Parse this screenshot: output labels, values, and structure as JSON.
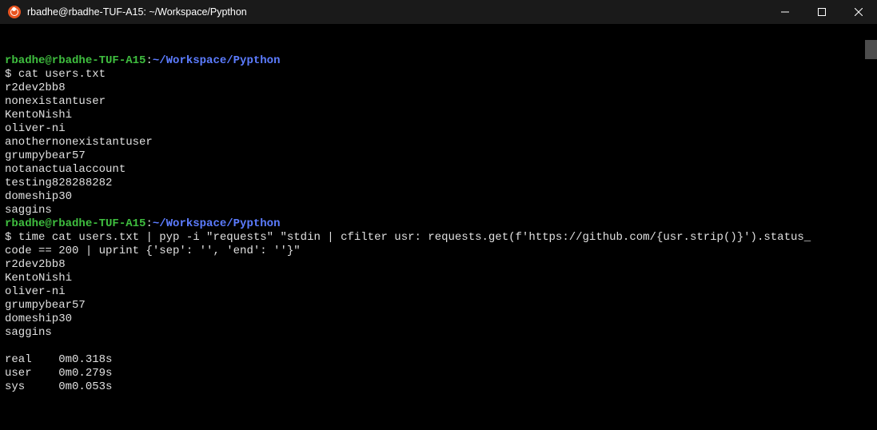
{
  "window": {
    "title": "rbadhe@rbadhe-TUF-A15: ~/Workspace/Pypthon",
    "icon": "ubuntu-icon"
  },
  "prompt": {
    "user_host": "rbadhe@rbadhe-TUF-A15",
    "sep": ":",
    "path": "~/Workspace/Pypthon",
    "symbol": "$"
  },
  "session": [
    {
      "type": "prompt"
    },
    {
      "type": "cmd",
      "text": "cat users.txt"
    },
    {
      "type": "out",
      "text": "r2dev2bb8"
    },
    {
      "type": "out",
      "text": "nonexistantuser"
    },
    {
      "type": "out",
      "text": "KentoNishi"
    },
    {
      "type": "out",
      "text": "oliver-ni"
    },
    {
      "type": "out",
      "text": "anothernonexistantuser"
    },
    {
      "type": "out",
      "text": "grumpybear57"
    },
    {
      "type": "out",
      "text": "notanactualaccount"
    },
    {
      "type": "out",
      "text": "testing828288282"
    },
    {
      "type": "out",
      "text": "domeship30"
    },
    {
      "type": "out",
      "text": "saggins"
    },
    {
      "type": "prompt"
    },
    {
      "type": "cmd",
      "text": "time cat users.txt | pyp -i \"requests\" \"stdin | cfilter usr: requests.get(f'https://github.com/{usr.strip()}').status_"
    },
    {
      "type": "cmd-cont",
      "text": "code == 200 | uprint {'sep': '', 'end': ''}\""
    },
    {
      "type": "out",
      "text": "r2dev2bb8"
    },
    {
      "type": "out",
      "text": "KentoNishi"
    },
    {
      "type": "out",
      "text": "oliver-ni"
    },
    {
      "type": "out",
      "text": "grumpybear57"
    },
    {
      "type": "out",
      "text": "domeship30"
    },
    {
      "type": "out",
      "text": "saggins"
    },
    {
      "type": "out",
      "text": ""
    },
    {
      "type": "out",
      "text": "real    0m0.318s"
    },
    {
      "type": "out",
      "text": "user    0m0.279s"
    },
    {
      "type": "out",
      "text": "sys     0m0.053s"
    }
  ]
}
